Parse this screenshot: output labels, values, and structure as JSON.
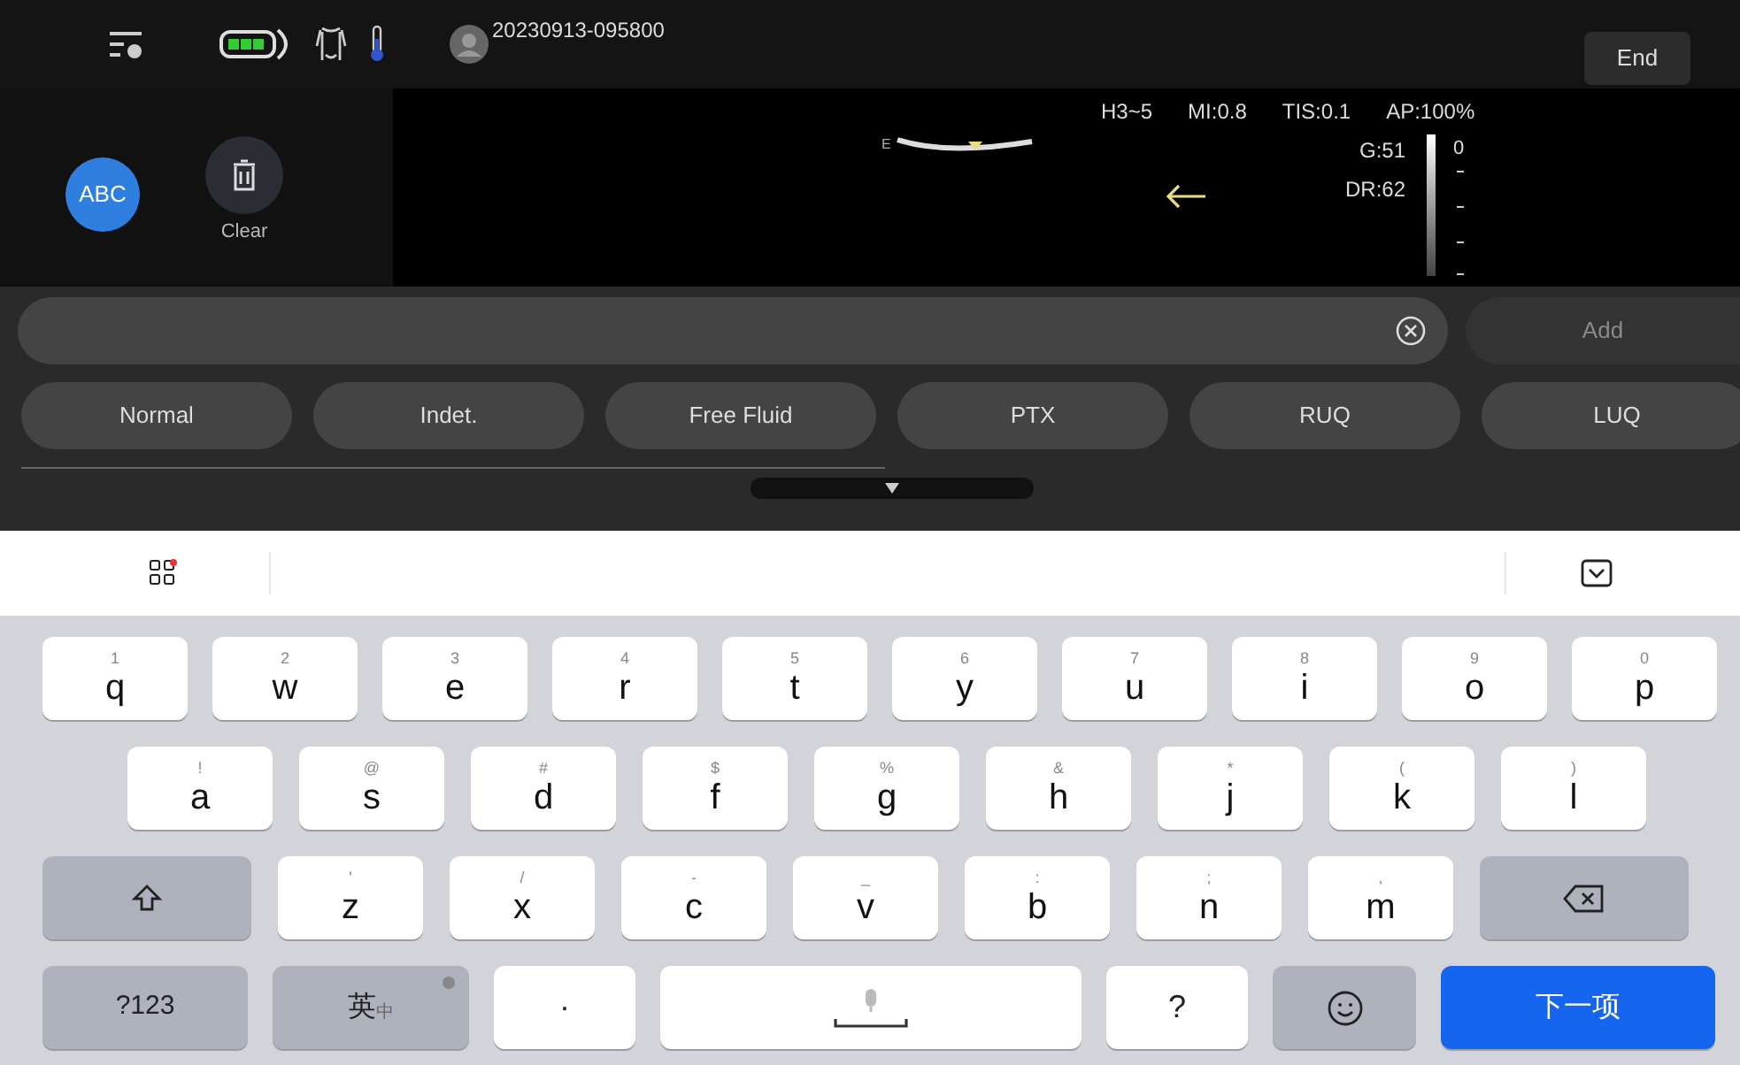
{
  "top_bar": {
    "patient_id": "20230913-095800",
    "end_button": "End"
  },
  "side_panel": {
    "abc_button": "ABC",
    "clear_button": "Clear"
  },
  "image_info": {
    "params": [
      "H3~5",
      "MI:0.8",
      "TIS:0.1",
      "AP:100%"
    ],
    "gain": "G:51",
    "dynamic_range": "DR:62",
    "orientation_mark": "E",
    "depth_label": "0"
  },
  "annotation": {
    "add_button": {
      "label": "Add",
      "disabled": true
    },
    "chips": [
      "Normal",
      "Indet.",
      "Free Fluid",
      "PTX",
      "RUQ",
      "LUQ"
    ]
  },
  "keyboard": {
    "rows": [
      [
        {
          "kind": "letter",
          "label": "q",
          "hint": "1"
        },
        {
          "kind": "letter",
          "label": "w",
          "hint": "2"
        },
        {
          "kind": "letter",
          "label": "e",
          "hint": "3"
        },
        {
          "kind": "letter",
          "label": "r",
          "hint": "4"
        },
        {
          "kind": "letter",
          "label": "t",
          "hint": "5"
        },
        {
          "kind": "letter",
          "label": "y",
          "hint": "6"
        },
        {
          "kind": "letter",
          "label": "u",
          "hint": "7"
        },
        {
          "kind": "letter",
          "label": "i",
          "hint": "8"
        },
        {
          "kind": "letter",
          "label": "o",
          "hint": "9"
        },
        {
          "kind": "letter",
          "label": "p",
          "hint": "0"
        }
      ],
      [
        {
          "kind": "letter",
          "label": "a",
          "hint": "!"
        },
        {
          "kind": "letter",
          "label": "s",
          "hint": "@"
        },
        {
          "kind": "letter",
          "label": "d",
          "hint": "#"
        },
        {
          "kind": "letter",
          "label": "f",
          "hint": "$"
        },
        {
          "kind": "letter",
          "label": "g",
          "hint": "%"
        },
        {
          "kind": "letter",
          "label": "h",
          "hint": "&"
        },
        {
          "kind": "letter",
          "label": "j",
          "hint": "*"
        },
        {
          "kind": "letter",
          "label": "k",
          "hint": "("
        },
        {
          "kind": "letter",
          "label": "l",
          "hint": ")"
        }
      ],
      [
        {
          "kind": "shift"
        },
        {
          "kind": "letter",
          "label": "z",
          "hint": "'"
        },
        {
          "kind": "letter",
          "label": "x",
          "hint": "/"
        },
        {
          "kind": "letter",
          "label": "c",
          "hint": "-"
        },
        {
          "kind": "letter",
          "label": "v",
          "hint": "_"
        },
        {
          "kind": "letter",
          "label": "b",
          "hint": ":"
        },
        {
          "kind": "letter",
          "label": "n",
          "hint": ";"
        },
        {
          "kind": "letter",
          "label": "m",
          "hint": ","
        },
        {
          "kind": "backspace"
        }
      ],
      [
        {
          "kind": "mode",
          "label": "?123"
        },
        {
          "kind": "language",
          "label": "英",
          "sub": "中"
        },
        {
          "kind": "char",
          "label": "·"
        },
        {
          "kind": "space"
        },
        {
          "kind": "char",
          "label": "?"
        },
        {
          "kind": "emoji"
        },
        {
          "kind": "enter",
          "label": "下一项"
        }
      ]
    ]
  }
}
